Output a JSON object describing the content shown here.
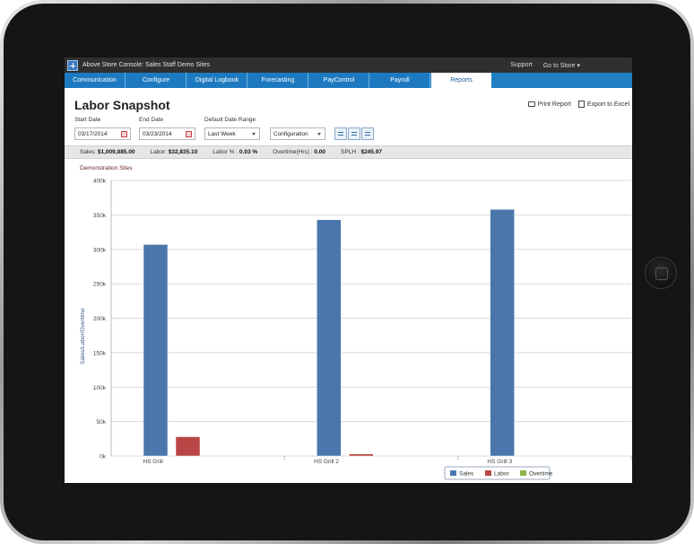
{
  "window": {
    "title": "Above Store Console: Sales Staff Demo Sites",
    "links": [
      "Support",
      "Go to Store ▾"
    ]
  },
  "tabs": [
    {
      "label": "Communication",
      "active": false
    },
    {
      "label": "Configure",
      "active": false
    },
    {
      "label": "Digital Logbook",
      "active": false
    },
    {
      "label": "Forecasting",
      "active": false
    },
    {
      "label": "PayControl",
      "active": false
    },
    {
      "label": "Payroll",
      "active": false
    },
    {
      "label": "Reports",
      "active": true
    }
  ],
  "page": {
    "title": "Labor Snapshot",
    "print_label": "Print Report",
    "excel_label": "Export to Excel"
  },
  "filters": {
    "start_label": "Start Date",
    "start_value": "03/17/2014",
    "end_label": "End Date",
    "end_value": "03/23/2014",
    "range_label": "Default Date Range",
    "range_value": "Last Week",
    "config_value": "Configuration"
  },
  "summary": {
    "sales_label": "Sales:",
    "sales_value": "$1,009,885.00",
    "labor_label": "Labor:",
    "labor_value": "$32,835.10",
    "laborpct_label": "Labor % :",
    "laborpct_value": "0.03 %",
    "overtime_label": "Overtime(Hrs) :",
    "overtime_value": "0.00",
    "splh_label": "SPLH :",
    "splh_value": "$245.97"
  },
  "colors": {
    "sales": "#4a76ab",
    "labor": "#b94545",
    "overtime": "#8cb349"
  },
  "chart_data": {
    "type": "bar",
    "title": "Demonstration Sites",
    "ylabel": "Sales/Labor/Overtime",
    "xlabel": "",
    "categories": [
      "HS Grill",
      "HS Grill 2",
      "HS Grill 3"
    ],
    "series": [
      {
        "name": "Sales",
        "values": [
          307000,
          343000,
          358000
        ]
      },
      {
        "name": "Labor",
        "values": [
          28000,
          3000,
          0
        ]
      },
      {
        "name": "Overtime",
        "values": [
          0,
          0,
          0
        ]
      }
    ],
    "ylim": [
      0,
      400000
    ],
    "yticks": [
      "0k",
      "50k",
      "100k",
      "150k",
      "200k",
      "250k",
      "300k",
      "350k",
      "400k"
    ],
    "grid": true,
    "legend": "bottom-right"
  }
}
